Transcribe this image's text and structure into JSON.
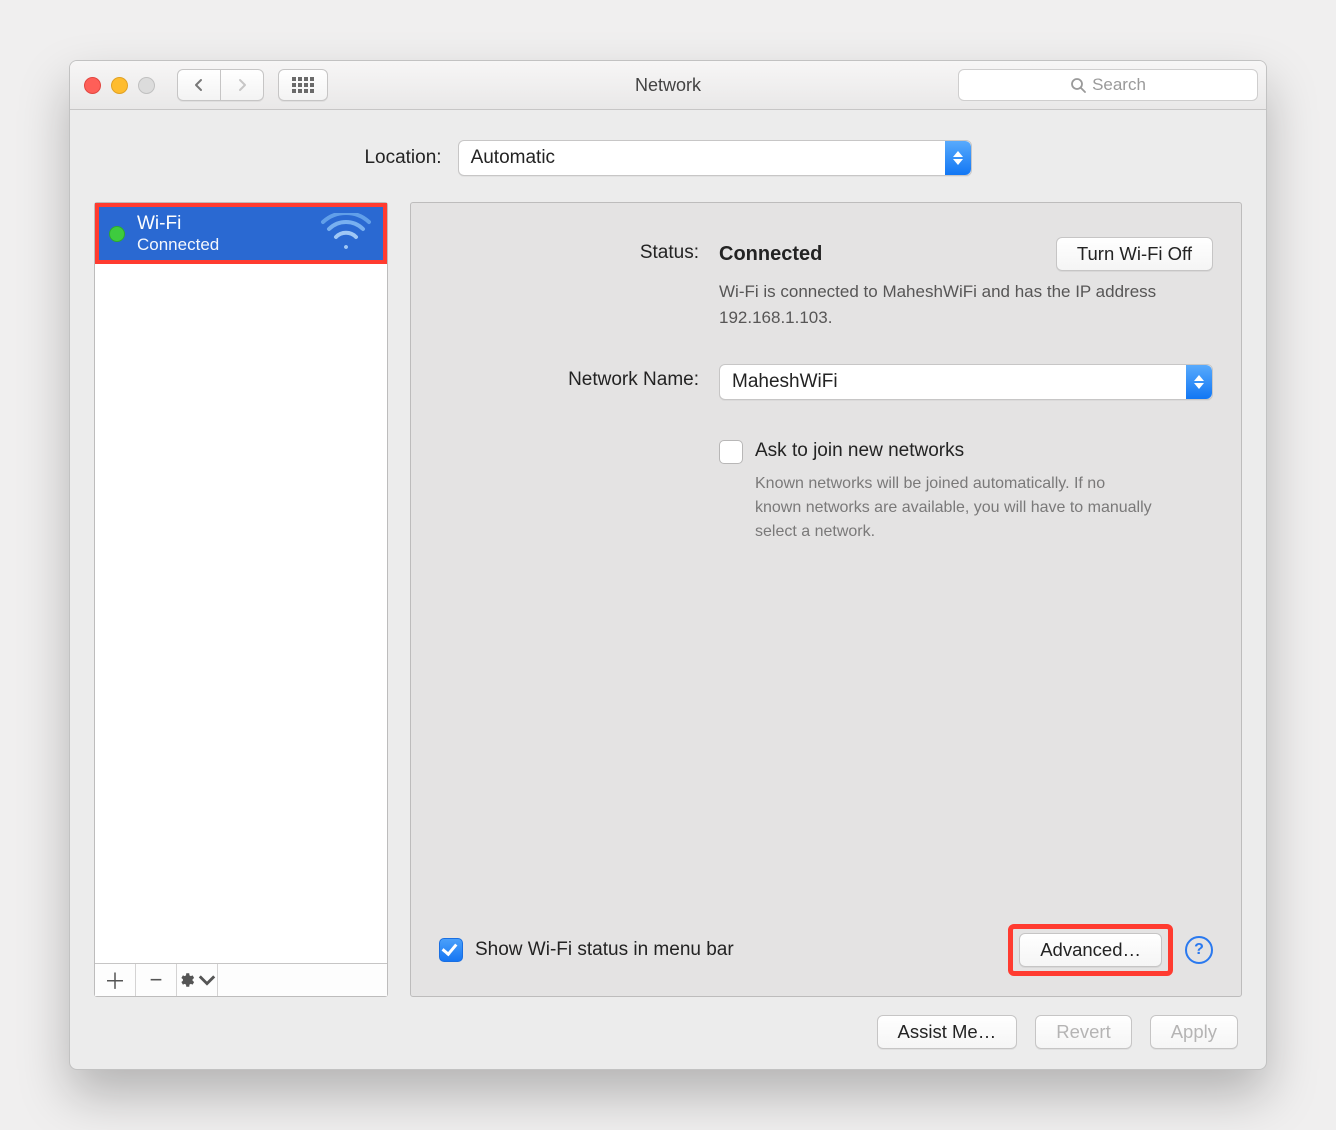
{
  "titlebar": {
    "title": "Network",
    "search_placeholder": "Search"
  },
  "location": {
    "label": "Location:",
    "value": "Automatic"
  },
  "sidebar": {
    "services": [
      {
        "name": "Wi-Fi",
        "subtitle": "Connected",
        "status": "green",
        "selected": true
      }
    ]
  },
  "right": {
    "status_label": "Status:",
    "status_value": "Connected",
    "toggle_button": "Turn Wi-Fi Off",
    "status_description": "Wi-Fi is connected to MaheshWiFi and has the IP address 192.168.1.103.",
    "network_name_label": "Network Name:",
    "network_name_value": "MaheshWiFi",
    "ask_join_label": "Ask to join new networks",
    "ask_join_checked": false,
    "ask_join_help": "Known networks will be joined automatically. If no known networks are available, you will have to manually select a network.",
    "show_status_label": "Show Wi-Fi status in menu bar",
    "show_status_checked": true,
    "advanced_button": "Advanced…"
  },
  "footer": {
    "assist": "Assist Me…",
    "revert": "Revert",
    "apply": "Apply"
  }
}
